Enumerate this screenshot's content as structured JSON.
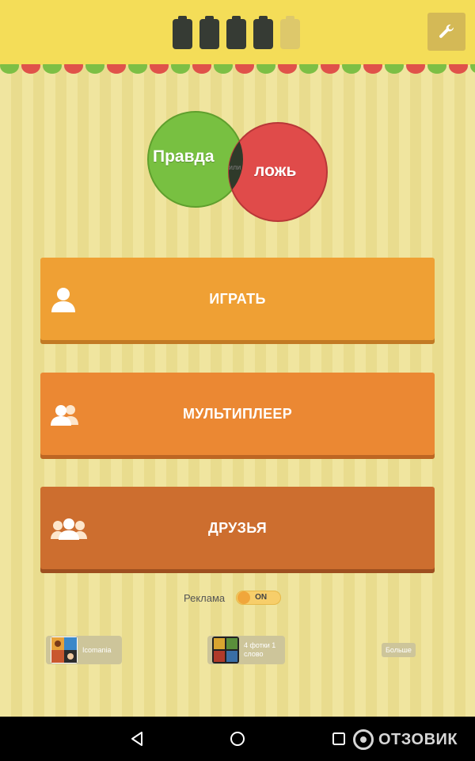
{
  "top_bar": {
    "lives": [
      {
        "state": "full"
      },
      {
        "state": "full"
      },
      {
        "state": "full"
      },
      {
        "state": "full"
      },
      {
        "state": "empty"
      }
    ],
    "lives_remaining": 4,
    "lives_total": 5,
    "settings_icon": "wrench-icon"
  },
  "logo": {
    "left_word": "Правда",
    "middle_word": "или",
    "right_word": "ложь",
    "colors": {
      "left_circle": "#78c041",
      "right_circle": "#e04b4a",
      "overlap": "#2f3a2a"
    }
  },
  "menu": {
    "play": {
      "label": "ИГРАТЬ",
      "icon": "single-user-icon"
    },
    "multiplayer": {
      "label": "МУЛЬТИПЛЕЕР",
      "icon": "two-users-icon"
    },
    "friends": {
      "label": "ДРУЗЬЯ",
      "icon": "group-users-icon"
    }
  },
  "ads": {
    "label": "Реклама",
    "toggle_state": "ON",
    "enabled": true
  },
  "promos": [
    {
      "title": "Icomania",
      "icon": "icomania-app-icon"
    },
    {
      "title": "4 фотки 1 слово",
      "icon": "four-photos-app-icon"
    }
  ],
  "more_label": "Больше",
  "nav": {
    "back_icon": "back-triangle-icon",
    "home_icon": "home-circle-icon",
    "recents_icon": "recents-square-icon"
  },
  "watermark": {
    "text": "ОТЗОВИК"
  },
  "colors": {
    "top_bar": "#f4dd58",
    "play_button": "#efa034",
    "multiplayer_button": "#eb8833",
    "friends_button": "#cd6e2f"
  }
}
